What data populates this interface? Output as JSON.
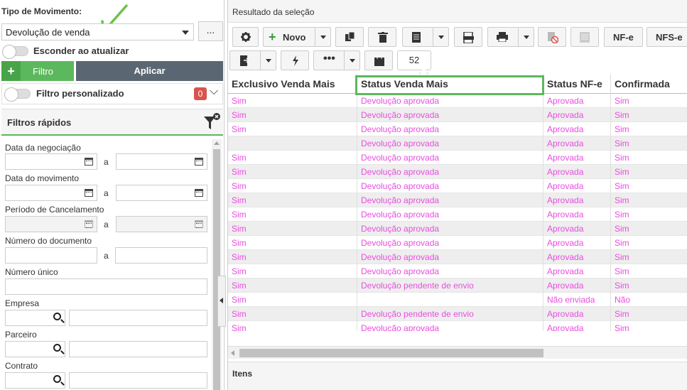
{
  "left": {
    "tipo_label": "Tipo de Movimento:",
    "tipo_value": "Devolução de venda",
    "dots_label": "...",
    "esconder_label": "Esconder ao atualizar",
    "filtro_label": "Filtro",
    "aplicar_label": "Aplicar",
    "filtro_pers_label": "Filtro personalizado",
    "filtro_pers_count": "0",
    "filtros_rapidos": "Filtros rápidos",
    "fields": {
      "data_negociacao": "Data da negociação",
      "data_movimento": "Data do movimento",
      "periodo_cancelamento": "Período de Cancelamento",
      "numero_documento": "Número do documento",
      "numero_unico": "Número único",
      "empresa": "Empresa",
      "parceiro": "Parceiro",
      "contrato": "Contrato"
    },
    "range_sep": "a",
    "annotation_color": "#6cc24a"
  },
  "right": {
    "title": "Resultado da seleção",
    "toolbar": {
      "novo": "Novo",
      "nfe": "NF-e",
      "nfse": "NFS-e",
      "count": "52"
    },
    "columns": [
      "Exclusivo Venda Mais",
      "Status Venda Mais",
      "Status NF-e",
      "Confirmada"
    ],
    "rows": [
      [
        "Sim",
        "Devolução aprovada",
        "Aprovada",
        "Sim"
      ],
      [
        "Sim",
        "Devolução aprovada",
        "Aprovada",
        "Sim"
      ],
      [
        "Sim",
        "Devolução aprovada",
        "Aprovada",
        "Sim"
      ],
      [
        "",
        "Devolução aprovada",
        "Aprovada",
        "Sim"
      ],
      [
        "Sim",
        "Devolução aprovada",
        "Aprovada",
        "Sim"
      ],
      [
        "Sim",
        "Devolução aprovada",
        "Aprovada",
        "Sim"
      ],
      [
        "Sim",
        "Devolução aprovada",
        "Aprovada",
        "Sim"
      ],
      [
        "Sim",
        "Devolução aprovada",
        "Aprovada",
        "Sim"
      ],
      [
        "Sim",
        "Devolução aprovada",
        "Aprovada",
        "Sim"
      ],
      [
        "Sim",
        "Devolução aprovada",
        "Aprovada",
        "Sim"
      ],
      [
        "Sim",
        "Devolução aprovada",
        "Aprovada",
        "Sim"
      ],
      [
        "Sim",
        "Devolução aprovada",
        "Aprovada",
        "Sim"
      ],
      [
        "Sim",
        "Devolução aprovada",
        "Aprovada",
        "Sim"
      ],
      [
        "Sim",
        "Devolução pendente de envio",
        "Aprovada",
        "Sim"
      ],
      [
        "Sim",
        "",
        "Não enviada",
        "Não"
      ],
      [
        "Sim",
        "Devolução pendente de envio",
        "Aprovada",
        "Sim"
      ],
      [
        "Sim",
        "Devolução aprovada",
        "Aprovada",
        "Sim"
      ]
    ],
    "cell_text_color": "#e84ddf",
    "highlight_color": "#5cb85c",
    "itens_title": "Itens"
  }
}
